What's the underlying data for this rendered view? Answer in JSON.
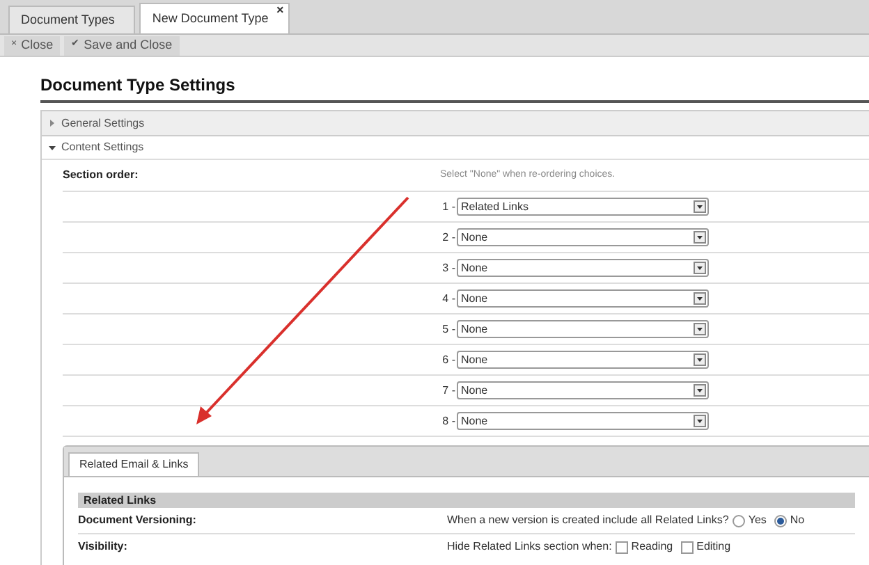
{
  "tabs": [
    {
      "label": "Document Types",
      "selected": false
    },
    {
      "label": "New Document Type",
      "selected": true,
      "close_glyph": "×"
    }
  ],
  "toolbar": [
    {
      "icon": "×",
      "label": "Close"
    },
    {
      "icon": "✔",
      "label": "Save and Close"
    }
  ],
  "title": "Document Type Settings",
  "sections": [
    {
      "label": "General Settings",
      "expanded": false
    },
    {
      "label": "Content Settings",
      "expanded": true
    }
  ],
  "section_order": {
    "label": "Section order:",
    "hint": "Select \"None\" when re-ordering choices.",
    "slots": [
      {
        "number": "1 -",
        "value": "Related Links"
      },
      {
        "number": "2 -",
        "value": "None"
      },
      {
        "number": "3 -",
        "value": "None"
      },
      {
        "number": "4 -",
        "value": "None"
      },
      {
        "number": "5 -",
        "value": "None"
      },
      {
        "number": "6 -",
        "value": "None"
      },
      {
        "number": "7 -",
        "value": "None"
      },
      {
        "number": "8 -",
        "value": "None"
      }
    ]
  },
  "inner_tabs": [
    {
      "label": "Related Email & Links",
      "selected": true
    }
  ],
  "group_heading": "Related Links",
  "fields": [
    {
      "label": "Document Versioning:",
      "kind": "radio",
      "prompt": "When a new version is created include all Related Links?",
      "options": [
        {
          "label": "Yes",
          "selected": false
        },
        {
          "label": "No",
          "selected": true
        }
      ]
    },
    {
      "label": "Visibility:",
      "kind": "checkbox",
      "prompt": "Hide Related Links section when:",
      "options": [
        {
          "label": "Reading",
          "checked": false
        },
        {
          "label": "Editing",
          "checked": false
        }
      ]
    }
  ]
}
